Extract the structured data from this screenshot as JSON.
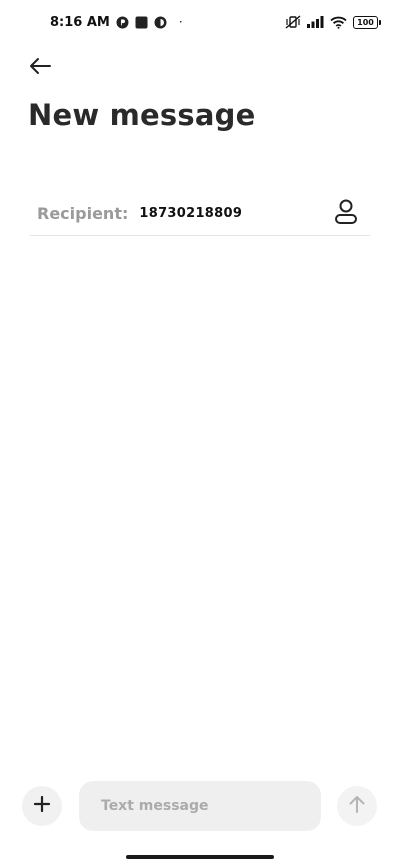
{
  "status_bar": {
    "time": "8:16 AM",
    "battery": "100",
    "dot": "·"
  },
  "header": {
    "title": "New message",
    "back_icon": "arrow-left-icon"
  },
  "recipient": {
    "label": "Recipient:",
    "value": "18730218809",
    "contact_icon": "person-icon"
  },
  "composer": {
    "placeholder": "Text message",
    "attach_icon": "plus-icon",
    "send_icon": "arrow-up-icon"
  },
  "colors": {
    "title": "#2a2a2a",
    "label_gray": "#9a9a9a",
    "input_bg": "#efefef",
    "divider": "#e4e4e4"
  }
}
